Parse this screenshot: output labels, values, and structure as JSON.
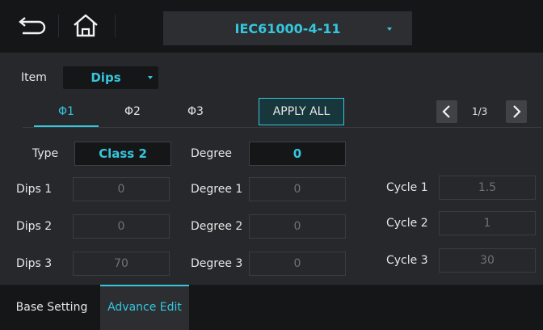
{
  "header": {
    "back_icon": "back-arrow-icon",
    "home_icon": "home-icon",
    "standard": "IEC61000-4-11"
  },
  "item": {
    "label": "Item",
    "value": "Dips"
  },
  "tabs": [
    {
      "label": "Φ1",
      "active": true
    },
    {
      "label": "Φ2",
      "active": false
    },
    {
      "label": "Φ3",
      "active": false
    }
  ],
  "apply_all": "APPLY ALL",
  "pager": {
    "text": "1/3"
  },
  "form": {
    "type_label": "Type",
    "type_value": "Class 2",
    "degree_label": "Degree",
    "degree_value": "0",
    "rows": [
      {
        "dips_label": "Dips 1",
        "dips_value": "0",
        "degree_label": "Degree 1",
        "degree_value": "0",
        "cycle_label": "Cycle 1",
        "cycle_value": "1.5"
      },
      {
        "dips_label": "Dips 2",
        "dips_value": "0",
        "degree_label": "Degree 2",
        "degree_value": "0",
        "cycle_label": "Cycle 2",
        "cycle_value": "1"
      },
      {
        "dips_label": "Dips 3",
        "dips_value": "70",
        "degree_label": "Degree 3",
        "degree_value": "0",
        "cycle_label": "Cycle 3",
        "cycle_value": "30"
      }
    ]
  },
  "bottom_tabs": [
    {
      "label": "Base Setting",
      "active": false
    },
    {
      "label": "Advance Edit",
      "active": true
    }
  ],
  "colors": {
    "accent": "#35c6dd",
    "background": "#26282b",
    "bar": "#151617"
  }
}
